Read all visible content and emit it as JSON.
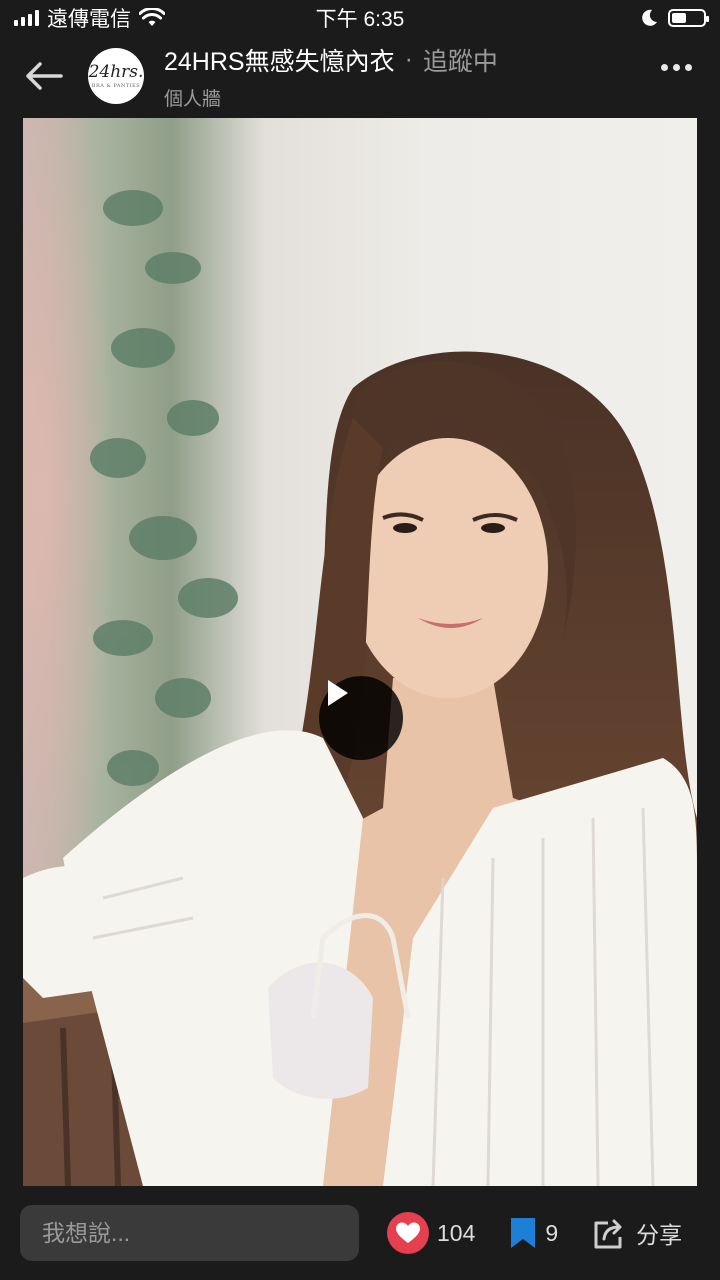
{
  "status_bar": {
    "carrier": "遠傳電信",
    "time": "下午 6:35",
    "battery_level": 0.45
  },
  "header": {
    "account_name": "24HRS無感失憶內衣",
    "separator": "·",
    "follow_status": "追蹤中",
    "subtitle": "個人牆",
    "avatar_logo_text": "24hrs.",
    "avatar_logo_sub": "BRA & PANTIES"
  },
  "media": {
    "type": "video",
    "state": "paused"
  },
  "footer": {
    "comment_placeholder": "我想說...",
    "like_count": "104",
    "bookmark_count": "9",
    "share_label": "分享"
  },
  "colors": {
    "background": "#1b1b1b",
    "like_accent": "#e4404f",
    "bookmark_accent": "#1e7fd6",
    "muted_text": "#9a9a9a"
  },
  "icons": [
    "back-arrow-icon",
    "more-icon",
    "play-icon",
    "heart-icon",
    "bookmark-icon",
    "share-icon",
    "wifi-icon",
    "moon-icon",
    "battery-icon",
    "signal-icon"
  ]
}
